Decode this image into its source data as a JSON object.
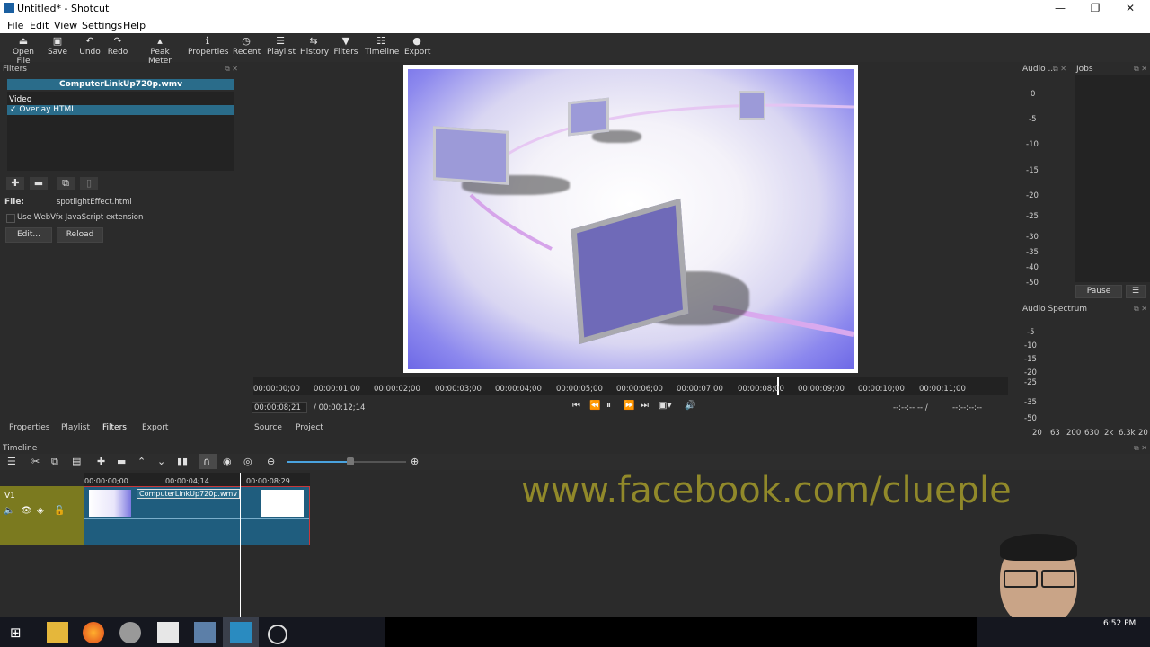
{
  "window": {
    "title": "Untitled* - Shotcut"
  },
  "menu": [
    "File",
    "Edit",
    "View",
    "Settings",
    "Help"
  ],
  "toolbar": [
    {
      "label": "Open File",
      "icon": "open-file-icon",
      "glyph": "⏏"
    },
    {
      "label": "Save",
      "icon": "save-icon",
      "glyph": "▣"
    },
    {
      "label": "Undo",
      "icon": "undo-icon",
      "glyph": "↶"
    },
    {
      "label": "Redo",
      "icon": "redo-icon",
      "glyph": "↷"
    },
    {
      "label": "Peak Meter",
      "icon": "peak-meter-icon",
      "glyph": "▴"
    },
    {
      "label": "Properties",
      "icon": "properties-icon",
      "glyph": "ℹ"
    },
    {
      "label": "Recent",
      "icon": "recent-icon",
      "glyph": "◷"
    },
    {
      "label": "Playlist",
      "icon": "playlist-icon",
      "glyph": "☰"
    },
    {
      "label": "History",
      "icon": "history-icon",
      "glyph": "⇆"
    },
    {
      "label": "Filters",
      "icon": "filters-icon",
      "glyph": "▼"
    },
    {
      "label": "Timeline",
      "icon": "timeline-icon",
      "glyph": "☷"
    },
    {
      "label": "Export",
      "icon": "export-icon",
      "glyph": "●"
    }
  ],
  "filters_panel": {
    "title": "Filters",
    "clip_name": "ComputerLinkUp720p.wmv",
    "section": "Video",
    "selected_filter": "Overlay HTML",
    "check": "✓",
    "file_label": "File:",
    "file_value": "spotlightEffect.html",
    "checkbox_label": "Use WebVfx JavaScript extension",
    "edit_button": "Edit...",
    "reload_button": "Reload"
  },
  "ruler": {
    "labels": [
      "00:00:00;00",
      "00:00:01;00",
      "00:00:02;00",
      "00:00:03;00",
      "00:00:04;00",
      "00:00:05;00",
      "00:00:06;00",
      "00:00:07;00",
      "00:00:08;00",
      "00:00:09;00",
      "00:00:10;00",
      "00:00:11;00"
    ]
  },
  "timecode": {
    "position": "00:00:08;21",
    "duration": "/ 00:00:12;14",
    "in_point": "--:--:--:-- /",
    "out_point": "--:--:--:--"
  },
  "bottom_tabs": [
    "Properties",
    "Playlist",
    "Filters",
    "Export"
  ],
  "player_tabs": [
    "Source",
    "Project"
  ],
  "audio_meter": {
    "title": "Audio ...",
    "scale": [
      "0",
      "-5",
      "-10",
      "-15",
      "-20",
      "-25",
      "-30",
      "-35",
      "-40",
      "-50"
    ]
  },
  "jobs": {
    "title": "Jobs",
    "pause_button": "Pause"
  },
  "spectrum": {
    "title": "Audio Spectrum",
    "scale": [
      "-5",
      "-10",
      "-15",
      "-20",
      "-25",
      "-35",
      "-50"
    ],
    "freqs": [
      "20",
      "63",
      "200",
      "630",
      "2k",
      "6.3k",
      "20"
    ]
  },
  "timeline": {
    "title": "Timeline",
    "ruler": [
      "00:00:00;00",
      "00:00:04;14",
      "00:00:08;29"
    ],
    "track_name": "V1",
    "clip_name": "ComputerLinkUp720p.wmv"
  },
  "watermark": "www.facebook.com/clueple",
  "clock": "6:52 PM"
}
